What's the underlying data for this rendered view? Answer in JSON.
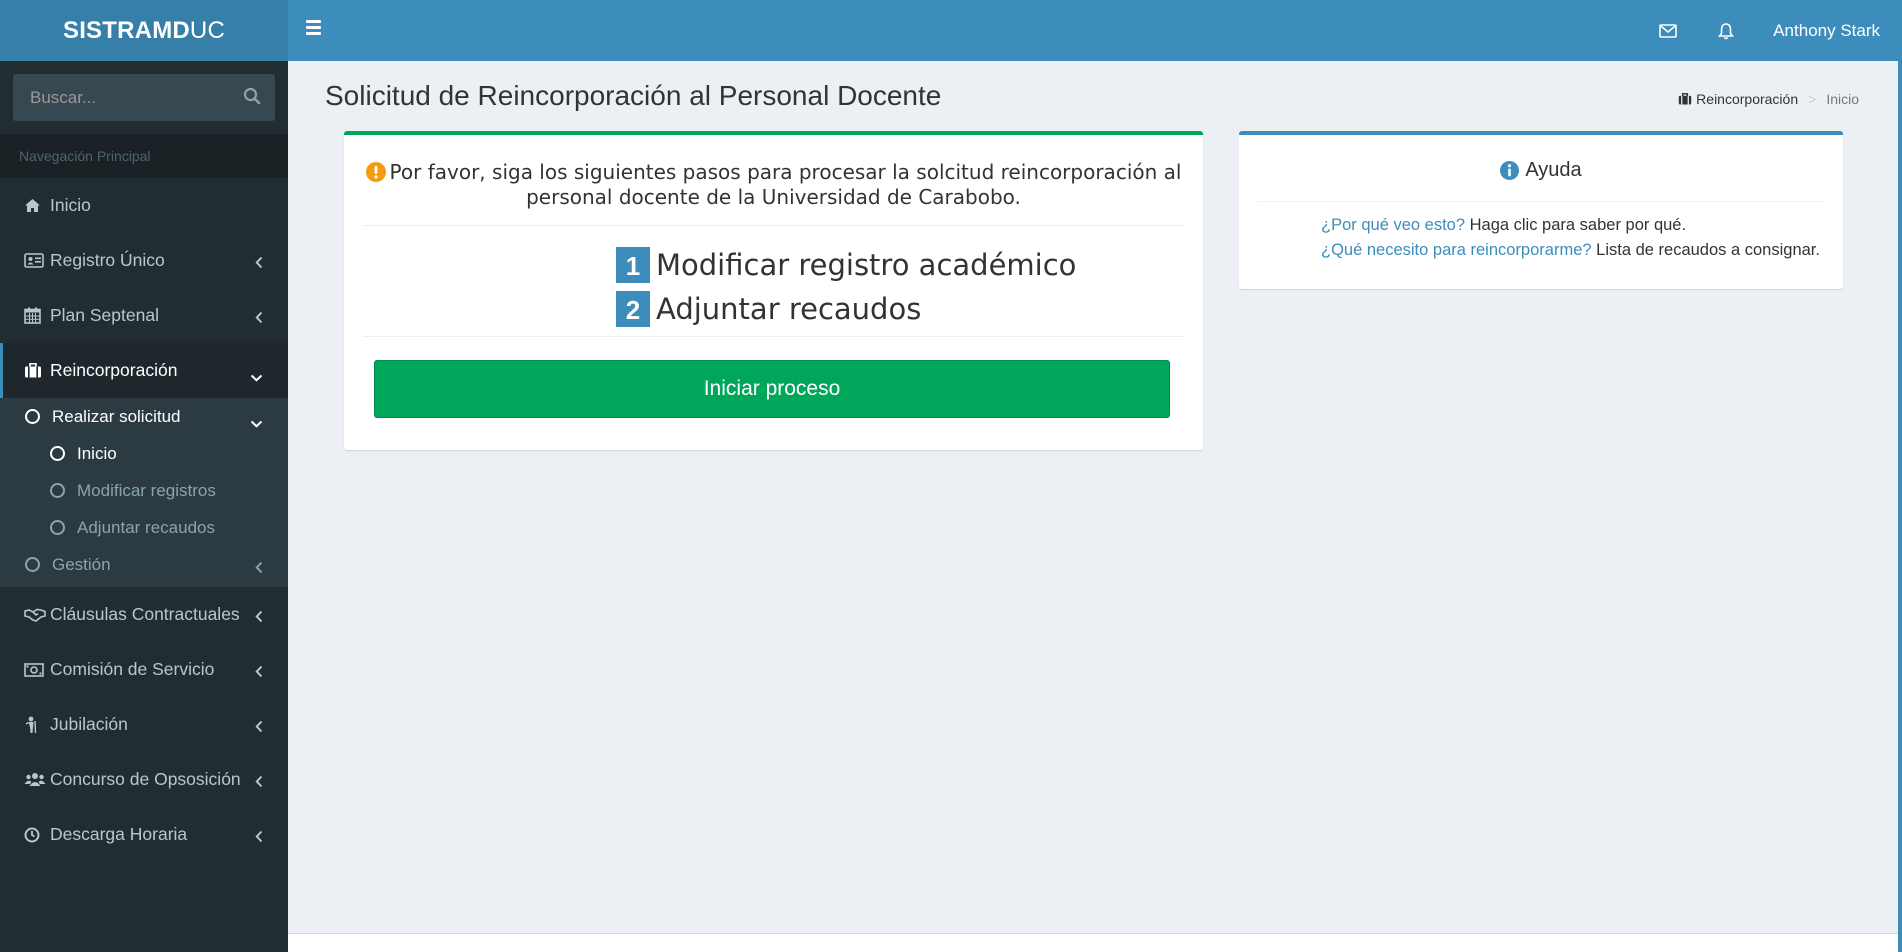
{
  "app": {
    "logo_bold": "SISTRAMD",
    "logo_light": "UC",
    "user_name": "Anthony Stark"
  },
  "sidebar": {
    "search_placeholder": "Buscar...",
    "nav_header": "Navegación Principal",
    "items": [
      {
        "label": "Inicio",
        "icon": "home-icon"
      },
      {
        "label": "Registro Único",
        "icon": "id-card-icon"
      },
      {
        "label": "Plan Septenal",
        "icon": "calendar-icon"
      },
      {
        "label": "Reincorporación",
        "icon": "briefcase-icon"
      },
      {
        "label": "Cláusulas Contractuales",
        "icon": "handshake-icon"
      },
      {
        "label": "Comisión de Servicio",
        "icon": "money-icon"
      },
      {
        "label": "Jubilación",
        "icon": "person-icon"
      },
      {
        "label": "Concurso de Opsosición",
        "icon": "users-icon"
      },
      {
        "label": "Descarga Horaria",
        "icon": "clock-icon"
      }
    ],
    "submenu": {
      "realizar": "Realizar solicitud",
      "inicio": "Inicio",
      "modificar": "Modificar registros",
      "adjuntar": "Adjuntar recaudos",
      "gestion": "Gestión"
    }
  },
  "content": {
    "title": "Solicitud de Reincorporación al Personal Docente",
    "breadcrumb": [
      "Reincorporación",
      "Inicio"
    ],
    "instructions": "Por favor, siga los siguientes pasos para procesar la solcitud reincorporación al personal docente de la Universidad de Carabobo.",
    "steps": [
      {
        "num": "1",
        "label": "Modificar registro académico"
      },
      {
        "num": "2",
        "label": "Adjuntar recaudos"
      }
    ],
    "start_button": "Iniciar proceso"
  },
  "help": {
    "title": "Ayuda",
    "lines": [
      {
        "link": "¿Por qué veo esto?",
        "text": "Haga clic para saber por qué."
      },
      {
        "link": "¿Qué necesito para reincorporarme?",
        "text": "Lista de recaudos a consignar."
      }
    ]
  },
  "colors": {
    "header": "#3c8dbc",
    "logo_bg": "#367fa9",
    "sidebar": "#222d32",
    "success": "#00a65a",
    "warning": "#f39c12"
  }
}
